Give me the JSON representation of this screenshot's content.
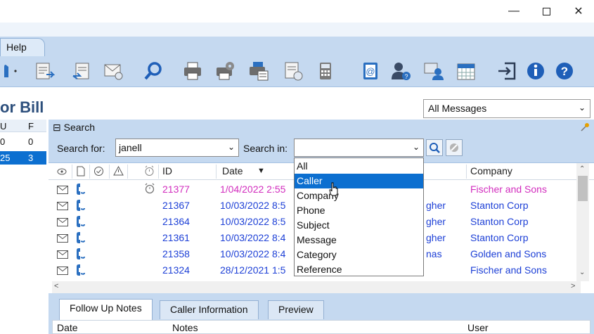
{
  "window": {
    "minimize": "—",
    "close": "✕"
  },
  "menu": {
    "help": "Help"
  },
  "toolbar": {
    "icons": [
      "phone-icon",
      "new-message-icon",
      "reply-icon",
      "delete-message-icon",
      "search-icon",
      "print-icon",
      "print-setup-icon",
      "print-preview-icon",
      "export-icon",
      "calculator-icon",
      "address-book-icon",
      "user-help-icon",
      "user-screen-icon",
      "calendar-icon",
      "logout-icon",
      "info-icon",
      "help-icon"
    ]
  },
  "header": {
    "title": "or Bill",
    "view_select": "All Messages"
  },
  "left_grid": {
    "cols": [
      "U",
      "F"
    ],
    "rows": [
      [
        "0",
        "0"
      ],
      [
        "25",
        "3"
      ]
    ]
  },
  "search": {
    "header": "Search",
    "search_for_label": "Search for:",
    "search_for_value": "janell",
    "search_in_label": "Search in:",
    "search_in_value": ""
  },
  "grid": {
    "columns": {
      "id": "ID",
      "date": "Date",
      "company": "Company"
    },
    "rows": [
      {
        "id": "21377",
        "date": "1/04/2022 2:55",
        "caller": "",
        "company": "Fischer and Sons",
        "color": "pink"
      },
      {
        "id": "21367",
        "date": "10/03/2022 8:5",
        "caller": "gher",
        "company": "Stanton Corp",
        "color": "blue"
      },
      {
        "id": "21364",
        "date": "10/03/2022 8:5",
        "caller": "gher",
        "company": "Stanton Corp",
        "color": "blue"
      },
      {
        "id": "21361",
        "date": "10/03/2022 8:4",
        "caller": "gher",
        "company": "Stanton Corp",
        "color": "blue"
      },
      {
        "id": "21358",
        "date": "10/03/2022 8:4",
        "caller": "nas",
        "company": "Golden and Sons",
        "color": "blue"
      },
      {
        "id": "21324",
        "date": "28/12/2021 1:5",
        "caller": "",
        "company": "Fischer and Sons",
        "color": "blue"
      }
    ]
  },
  "dropdown": {
    "options": [
      "All",
      "Caller",
      "Company",
      "Phone",
      "Subject",
      "Message",
      "Category",
      "Reference"
    ],
    "highlighted": "Caller"
  },
  "bottom_tabs": {
    "tabs": [
      "Follow Up Notes",
      "Caller Information",
      "Preview"
    ],
    "columns": {
      "date": "Date",
      "notes": "Notes",
      "user": "User"
    }
  },
  "colors": {
    "accent": "#0c6fd0",
    "panel": "#c5d9f0",
    "pink_row": "#d22dbe",
    "blue_row": "#1c3fd6"
  }
}
